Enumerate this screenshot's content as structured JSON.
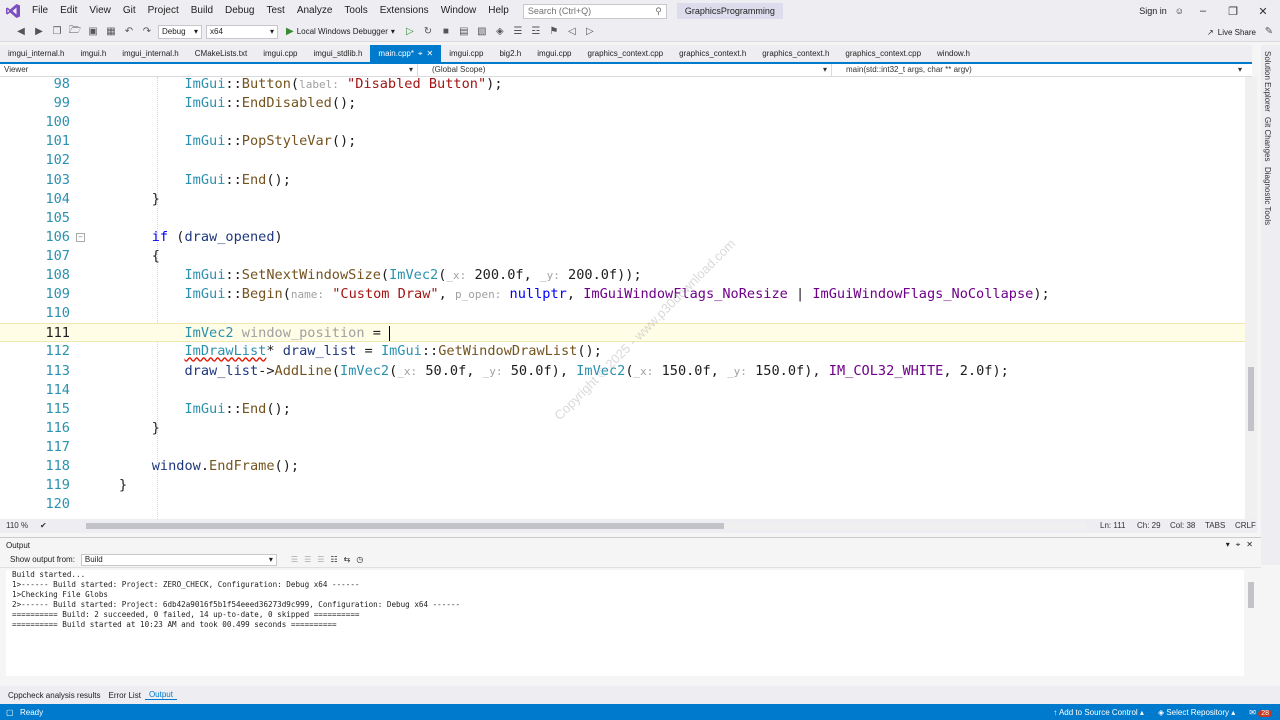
{
  "menu": {
    "items": [
      "File",
      "Edit",
      "View",
      "Git",
      "Project",
      "Build",
      "Debug",
      "Test",
      "Analyze",
      "Tools",
      "Extensions",
      "Window",
      "Help"
    ],
    "search_placeholder": "Search (Ctrl+Q)",
    "solution_name": "GraphicsProgramming",
    "signin": "Sign in"
  },
  "toolbar": {
    "config": "Debug",
    "platform": "x64",
    "run_label": "Local Windows Debugger",
    "liveshare": "Live Share"
  },
  "tabs": [
    {
      "label": "imgui_internal.h",
      "active": false
    },
    {
      "label": "imgui.h",
      "active": false
    },
    {
      "label": "imgui_internal.h",
      "active": false
    },
    {
      "label": "CMakeLists.txt",
      "active": false
    },
    {
      "label": "imgui.cpp",
      "active": false
    },
    {
      "label": "imgui_stdlib.h",
      "active": false
    },
    {
      "label": "main.cpp*",
      "active": true
    },
    {
      "label": "imgui.cpp",
      "active": false
    },
    {
      "label": "big2.h",
      "active": false
    },
    {
      "label": "imgui.cpp",
      "active": false
    },
    {
      "label": "graphics_context.cpp",
      "active": false
    },
    {
      "label": "graphics_context.h",
      "active": false
    },
    {
      "label": "graphics_context.h",
      "active": false
    },
    {
      "label": "graphics_context.cpp",
      "active": false
    },
    {
      "label": "window.h",
      "active": false
    }
  ],
  "navbar": {
    "project": "Viewer",
    "scope": "(Global Scope)",
    "member": "main(std::int32_t args, char ** argv)"
  },
  "editor": {
    "current_line": 111,
    "lines": [
      {
        "num": "98",
        "html": "        <span class='t'>ImGui</span>::<span class='f'>Button</span>(<span class='hint'>label:</span> <span class='s'>\"Disabled Button\"</span>);"
      },
      {
        "num": "99",
        "html": "        <span class='t'>ImGui</span>::<span class='f'>EndDisabled</span>();"
      },
      {
        "num": "100",
        "html": ""
      },
      {
        "num": "101",
        "html": "        <span class='t'>ImGui</span>::<span class='f'>PopStyleVar</span>();"
      },
      {
        "num": "102",
        "html": ""
      },
      {
        "num": "103",
        "html": "        <span class='t'>ImGui</span>::<span class='f'>End</span>();"
      },
      {
        "num": "104",
        "html": "    }"
      },
      {
        "num": "105",
        "html": ""
      },
      {
        "num": "106",
        "html": "    <span class='k'>if</span> (<span class='v'>draw_opened</span>)"
      },
      {
        "num": "107",
        "html": "    {"
      },
      {
        "num": "108",
        "html": "        <span class='t'>ImGui</span>::<span class='f'>SetNextWindowSize</span>(<span class='t'>ImVec2</span>(<span class='hint'>_x:</span> 200.0f, <span class='hint'>_y:</span> 200.0f));"
      },
      {
        "num": "109",
        "html": "        <span class='t'>ImGui</span>::<span class='f'>Begin</span>(<span class='hint'>name:</span> <span class='s'>\"Custom Draw\"</span>, <span class='hint'>p_open:</span> <span class='k'>nullptr</span>, <span class='m'>ImGuiWindowFlags_NoResize</span> | <span class='m'>ImGuiWindowFlags_NoCollapse</span>);"
      },
      {
        "num": "110",
        "html": ""
      },
      {
        "num": "111",
        "html": "        <span class='t'>ImVec2</span> <span class='ghost'>window_position</span> = <span class='cursor'></span>"
      },
      {
        "num": "112",
        "html": "        <span class='t squig'>ImDrawList</span>* <span class='v'>draw_list</span> = <span class='t'>ImGui</span>::<span class='f'>GetWindowDrawList</span>();"
      },
      {
        "num": "113",
        "html": "        <span class='v'>draw_list</span>-&gt;<span class='f'>AddLine</span>(<span class='t'>ImVec2</span>(<span class='hint'>_x:</span> 50.0f, <span class='hint'>_y:</span> 50.0f), <span class='t'>ImVec2</span>(<span class='hint'>_x:</span> 150.0f, <span class='hint'>_y:</span> 150.0f), <span class='m'>IM_COL32_WHITE</span>, 2.0f);"
      },
      {
        "num": "114",
        "html": ""
      },
      {
        "num": "115",
        "html": "        <span class='t'>ImGui</span>::<span class='f'>End</span>();"
      },
      {
        "num": "116",
        "html": "    }"
      },
      {
        "num": "117",
        "html": ""
      },
      {
        "num": "118",
        "html": "    <span class='v'>window</span>.<span class='f'>EndFrame</span>();"
      },
      {
        "num": "119",
        "html": "}"
      },
      {
        "num": "120",
        "html": ""
      }
    ]
  },
  "watermark": "Copyright © 2025 - www.p30download.com",
  "editor_status": {
    "zoom": "110 %",
    "ln": "Ln: 111",
    "ch": "Ch: 29",
    "col": "Col: 38",
    "tabs": "TABS",
    "eol": "CRLF"
  },
  "side_rail": [
    "Solution Explorer",
    "Git Changes",
    "Diagnostic Tools"
  ],
  "output": {
    "title": "Output",
    "show_from_label": "Show output from:",
    "source": "Build",
    "lines": [
      "Build started...",
      "1>------ Build started: Project: ZERO_CHECK, Configuration: Debug x64 ------",
      "1>Checking File Globs",
      "2>------ Build started: Project: 6db42a9016f5b1f54eeed36273d9c999, Configuration: Debug x64 ------",
      "========== Build: 2 succeeded, 0 failed, 14 up-to-date, 0 skipped ==========",
      "========== Build started at 10:23 AM and took 00.499 seconds =========="
    ]
  },
  "bottom_tabs": [
    {
      "label": "Cppcheck analysis results",
      "active": false
    },
    {
      "label": "Error List",
      "active": false
    },
    {
      "label": "Output",
      "active": true
    }
  ],
  "statusbar": {
    "ready": "Ready",
    "source_control": "Add to Source Control",
    "repository": "Select Repository",
    "notifications": "28"
  },
  "colors": {
    "accent": "#007acc",
    "chrome": "#eeeef2"
  }
}
